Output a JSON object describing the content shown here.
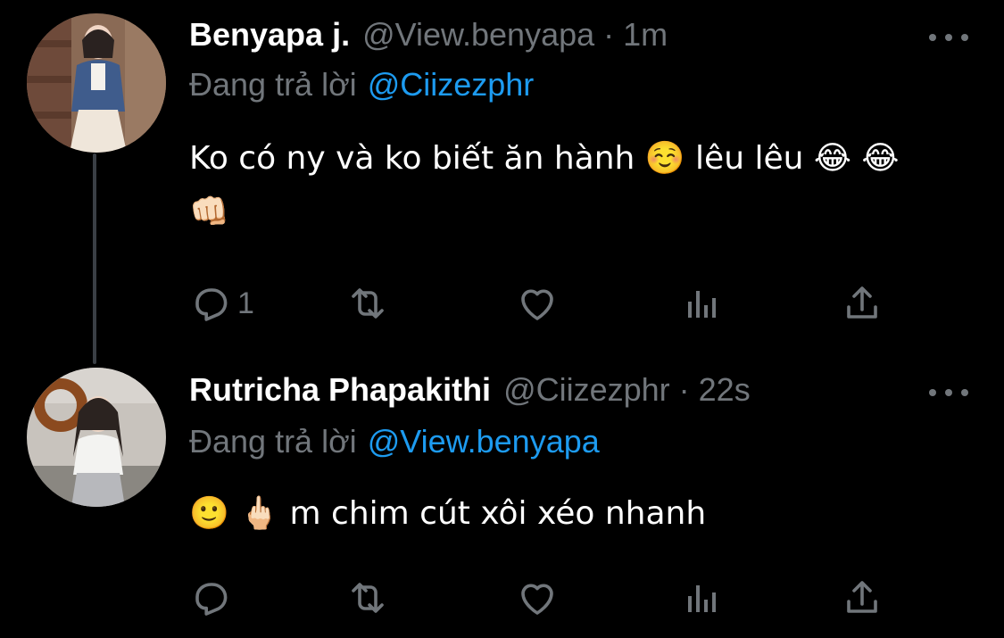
{
  "colors": {
    "background": "#000000",
    "name": "#ffffff",
    "meta": "#71767b",
    "mention": "#1d9bf0",
    "thread_line": "#3a3f45"
  },
  "tweets": [
    {
      "display_name": "Benyapa j.",
      "handle": "@View.benyapa",
      "separator": "·",
      "time": "1m",
      "reply_prefix": "Đang trả lời",
      "reply_to": "@Ciizezphr",
      "text_line_1": "Ko có ny và ko biết ăn hành ☺️  lêu lêu 😂 😂",
      "text_line_2": "👊🏻",
      "reply_count": "1",
      "icons": [
        "reply-icon",
        "retweet-icon",
        "like-icon",
        "views-icon",
        "share-icon"
      ]
    },
    {
      "display_name": "Rutricha Phapakithi",
      "handle": "@Ciizezphr",
      "separator": "·",
      "time": "22s",
      "reply_prefix": "Đang trả lời",
      "reply_to": "@View.benyapa",
      "text_line_1": "🙂 🖕🏻  m chim cút xôi xéo nhanh",
      "reply_count": "",
      "icons": [
        "reply-icon",
        "retweet-icon",
        "like-icon",
        "views-icon",
        "share-icon"
      ]
    }
  ]
}
